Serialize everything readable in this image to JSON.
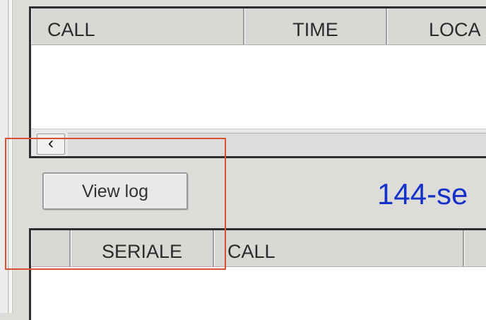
{
  "log_grid": {
    "columns": [
      "CALL",
      "TIME",
      "LOCA"
    ],
    "scroll_left_glyph": "‹"
  },
  "view_log_button": {
    "label": "View log"
  },
  "frequency_label": "144-se",
  "serial_grid": {
    "columns": [
      "",
      "SERIALE",
      "CALL",
      ""
    ]
  },
  "highlight": {
    "color": "#d8502f"
  }
}
